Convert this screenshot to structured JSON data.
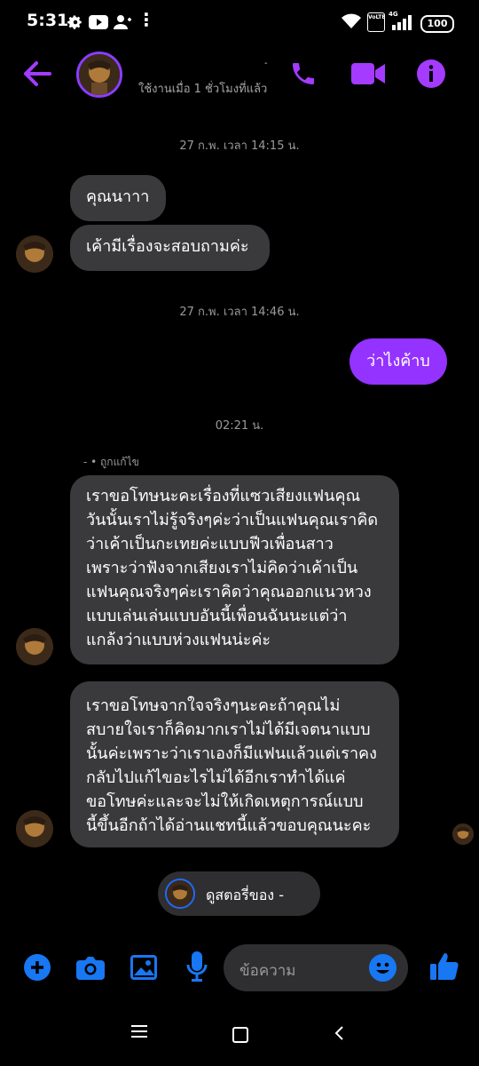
{
  "status_bar": {
    "time": "5:31",
    "battery": "100",
    "net": "4G",
    "volte": "VoLTE"
  },
  "header": {
    "status": "ใช้งานเมื่อ 1 ชั่วโมงที่แล้ว",
    "name_hint": "-"
  },
  "colors": {
    "accent_purple": "#9432ff",
    "icon_purple": "#a43bff",
    "composer_blue": "#1877f2",
    "bubble_gray": "#3a3a3c"
  },
  "messages": {
    "ts1": "27 ก.พ. เวลา 14:15 น.",
    "m1": "คุณนาาา",
    "m2": "เค้ามีเรื่องจะสอบถามค่ะ",
    "ts2": "27 ก.พ. เวลา 14:46 น.",
    "m3": "ว่าไงค้าบ",
    "ts3": "02:21 น.",
    "edited": "- • ถูกแก้ไข",
    "m4_lines": [
      "เราขอโทษนะคะเรื่องที่แซวเสียงแฟนคุณ",
      "วันนั้นเราไม่รู้จริงๆค่ะว่าเป็นแฟนคุณเราคิด",
      "ว่าเค้าเป็นกะเทยค่ะแบบฟีวเพื่อนสาว",
      "เพราะว่าฟังจากเสียงเราไม่คิดว่าเค้าเป็น",
      "แฟนคุณจริงๆค่ะเราคิดว่าคุณออกแนวหวง",
      "แบบเล่นเล่นแบบอันนี้เพื่อนฉันนะแต่ว่า",
      "แกล้งว่าแบบห่วงแฟนน่ะค่ะ"
    ],
    "m5_lines": [
      "เราขอโทษจากใจจริงๆนะคะถ้าคุณไม่",
      "สบายใจเราก็คิดมากเราไม่ได้มีเจตนาแบบ",
      "นั้นค่ะเพราะว่าเราเองก็มีแฟนแล้วแต่เราคง",
      "กลับไปแก้ไขอะไรไม่ได้อีกเราทำได้แค่",
      "ขอโทษค่ะและจะไม่ให้เกิดเหตุการณ์แบบ",
      "นี้ขึ้นอีกถ้าได้อ่านแชทนี้แล้วขอบคุณนะคะ"
    ]
  },
  "story": {
    "label": "ดูสตอรี่ของ -"
  },
  "composer": {
    "placeholder": "ข้อความ"
  },
  "icons": {
    "back": "arrow-left",
    "call": "phone",
    "video": "video-camera",
    "info": "info",
    "add": "plus-circle",
    "camera": "camera",
    "gallery": "image",
    "mic": "microphone",
    "emoji": "smiley",
    "like": "thumbs-up"
  }
}
